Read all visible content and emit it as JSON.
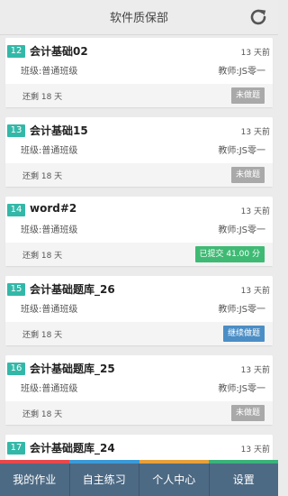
{
  "header": {
    "title": "软件质保部"
  },
  "assignments": [
    {
      "num": "12",
      "title": "会计基础02",
      "time": "13 天前",
      "class": "班级:普通班级",
      "teacher": "教师:JS零一",
      "remain": "还剩 18 天",
      "status": "未做题",
      "status_type": "grey"
    },
    {
      "num": "13",
      "title": "会计基础15",
      "time": "13 天前",
      "class": "班级:普通班级",
      "teacher": "教师:JS零一",
      "remain": "还剩 18 天",
      "status": "未做题",
      "status_type": "grey"
    },
    {
      "num": "14",
      "title": "word#2",
      "time": "13 天前",
      "class": "班级:普通班级",
      "teacher": "教师:JS零一",
      "remain": "还剩 18 天",
      "status": "已提交 41.00 分",
      "status_type": "green"
    },
    {
      "num": "15",
      "title": "会计基础题库_26",
      "time": "13 天前",
      "class": "班级:普通班级",
      "teacher": "教师:JS零一",
      "remain": "还剩 18 天",
      "status": "继续做题",
      "status_type": "blue"
    },
    {
      "num": "16",
      "title": "会计基础题库_25",
      "time": "13 天前",
      "class": "班级:普通班级",
      "teacher": "教师:JS零一",
      "remain": "还剩 18 天",
      "status": "未做题",
      "status_type": "grey"
    },
    {
      "num": "17",
      "title": "会计基础题库_24",
      "time": "13 天前",
      "class": "",
      "teacher": "",
      "remain": "",
      "status": "",
      "status_type": "grey"
    }
  ],
  "tabs": [
    {
      "label": "我的作业"
    },
    {
      "label": "自主练习"
    },
    {
      "label": "个人中心"
    },
    {
      "label": "设置"
    }
  ],
  "colors": {
    "accent_teal": "#33b8a8",
    "tabbar_bg": "#4d6a84",
    "status_grey": "#a9a9a9",
    "status_green": "#3fba74",
    "status_blue": "#4b8ec5",
    "strip": [
      "#e8474b",
      "#3a9ad9",
      "#e8a03a",
      "#38b37a"
    ]
  },
  "icons": {
    "refresh": "refresh-icon"
  }
}
